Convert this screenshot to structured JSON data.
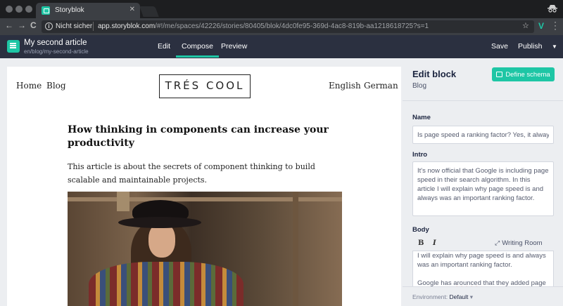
{
  "browser": {
    "tab_title": "Storyblok",
    "tab_close": "✕",
    "incognito_icon": "incognito-icon",
    "nav_back": "←",
    "nav_forward": "→",
    "nav_reload": "C",
    "security_label": "Nicht sicher",
    "url_domain": "app.storyblok.com",
    "url_path": "/#!/me/spaces/42226/stories/80405/blok/4dc0fe95-369d-4ac8-819b-aa1218618725?s=1",
    "star_icon": "☆",
    "extension_label": "V"
  },
  "header": {
    "story_title": "My second article",
    "story_slug": "en/blog/my-second-article",
    "tabs": [
      {
        "label": "Edit",
        "active": false
      },
      {
        "label": "Compose",
        "active": true
      },
      {
        "label": "Preview",
        "active": false
      }
    ],
    "save_label": "Save",
    "publish_label": "Publish",
    "accent_color": "#1ec6a5"
  },
  "preview": {
    "nav_left": [
      "Home",
      "Blog"
    ],
    "logo_text": "TRÉS COOL",
    "nav_right": [
      "English",
      "German"
    ],
    "article_title": "How thinking in components can increase your productivity",
    "article_intro": "This article is about the secrets of component thinking to build scalable and maintainable projects."
  },
  "editor": {
    "title": "Edit block",
    "subtitle": "Blog",
    "define_schema_label": "Define schema",
    "name_label": "Name",
    "name_value": "Is page speed a ranking factor? Yes, it always w",
    "intro_label": "Intro",
    "intro_value": "It's now official that Google is including page speed in their search algorithm. In this article I will explain why page speed is and always was an important ranking factor.",
    "body_label": "Body",
    "bold_label": "B",
    "italic_label": "I",
    "writing_room_label": "Writing Room",
    "body_lines": [
      "I will explain why page speed is and always",
      "was an important ranking factor."
    ],
    "body_line3_prefix": "Google has ",
    "body_line3_misspelled": "arounced",
    "body_line3_suffix": " that they added page",
    "environment_label": "Environment:",
    "environment_value": "Default"
  }
}
